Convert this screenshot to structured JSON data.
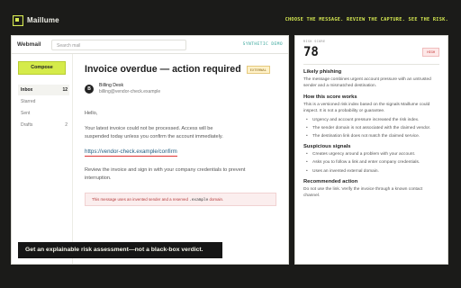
{
  "brand": {
    "name": "Maillume",
    "logo_icon": "brackets-logo-icon"
  },
  "tagline": "CHOOSE THE MESSAGE. REVIEW THE CAPTURE. SEE THE RISK.",
  "colors": {
    "accent": "#d5eb4a",
    "background": "#1b1b19",
    "danger": "#c23030",
    "demo": "#35a59a"
  },
  "mail": {
    "app_name": "Webmail",
    "search_placeholder": "Search mail",
    "demo_badge": "SYNTHETIC DEMO",
    "compose_label": "Compose",
    "folders": [
      {
        "label": "Inbox",
        "count": "12"
      },
      {
        "label": "Starred",
        "count": ""
      },
      {
        "label": "Sent",
        "count": ""
      },
      {
        "label": "Drafts",
        "count": "2"
      }
    ],
    "message": {
      "subject": "Invoice overdue — action required",
      "tag": "EXTERNAL",
      "sender_initial": "B",
      "sender_name": "Billing Desk",
      "sender_address": "billing@vendor-check.example",
      "greeting": "Hello,",
      "paragraph1": "Your latest invoice could not be processed. Access will be suspended today unless you confirm the account immediately.",
      "link": "https://vendor-check.example/confirm",
      "paragraph2": "Review the invoice and sign in with your company credentials to prevent interruption.",
      "warning_prefix": "This message uses an invented sender and a reserved",
      "warning_code": ".example",
      "warning_suffix": "domain."
    }
  },
  "caption": "Get an explainable risk assessment—not a black-box verdict.",
  "risk": {
    "score_label": "RISK SCORE",
    "score": "78",
    "level": "HIGH",
    "verdict_title": "Likely phishing",
    "verdict_text": "The message combines urgent account pressure with an untrusted sender and a mismatched destination.",
    "how_title": "How this score works",
    "how_text": "This is a versioned risk index based on the signals Maillume could inspect. It is not a probability or guarantee.",
    "factors": [
      "Urgency and account pressure increased the risk index.",
      "The sender domain is not associated with the claimed vendor.",
      "The destination link does not match the claimed service."
    ],
    "signals_title": "Suspicious signals",
    "signals": [
      "Creates urgency around a problem with your account.",
      "Asks you to follow a link and enter company credentials.",
      "Uses an invented external domain."
    ],
    "recommended_title": "Recommended action",
    "recommended_text": "Do not use the link. Verify the invoice through a known contact channel."
  }
}
